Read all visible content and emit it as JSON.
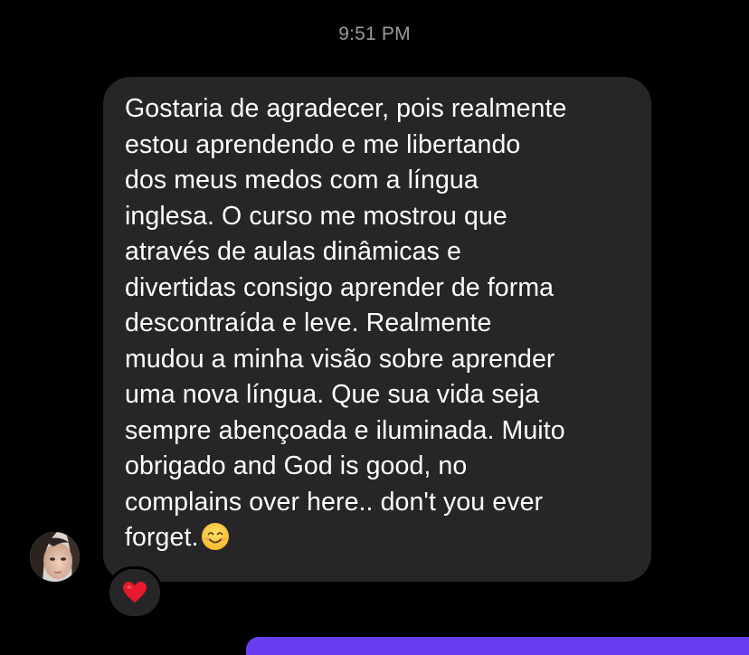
{
  "header": {
    "timestamp": "9:51 PM"
  },
  "message": {
    "sender_avatar_icon": "profile-photo",
    "text": "Gostaria de agradecer, pois realmente\nestou aprendendo e me libertando\ndos meus medos com a língua\ninglesa. O curso me mostrou que\natravés de aulas dinâmicas e\ndivertidas  consigo aprender de forma\ndescontraída  e leve. Realmente\nmudou a minha visão sobre aprender\numa nova língua. Que sua vida seja\nsempre abençoada e iluminada. Muito\nobrigado and God is good, no\ncomplains over here.. don't you ever\nforget.",
    "trailing_emoji_icon": "smiling-face-icon",
    "reaction_icon": "red-heart-icon"
  },
  "colors": {
    "background": "#000000",
    "bubble": "#262628",
    "text": "#ffffff",
    "timestamp": "#9a9a9e",
    "reaction_heart": "#e8192c",
    "outgoing_bubble": "#6b3df0"
  }
}
